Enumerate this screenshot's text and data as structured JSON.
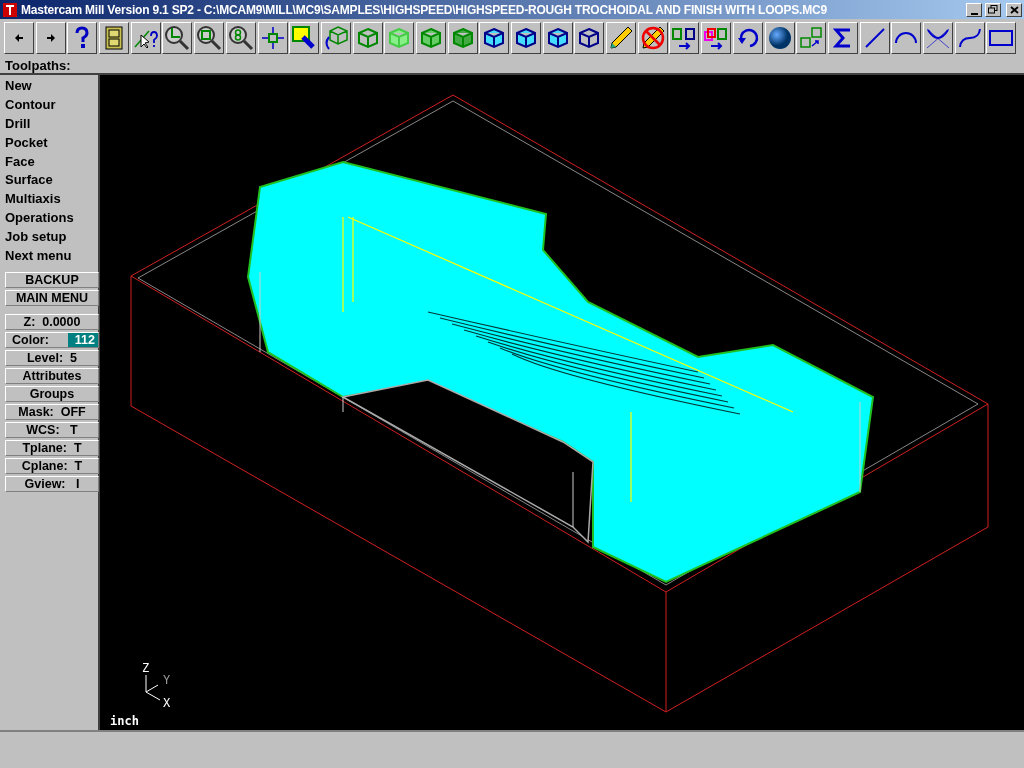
{
  "window": {
    "title": "Mastercam Mill Version 9.1 SP2 - C:\\MCAM9\\MILL\\MC9\\SAMPLES\\HIGHSPEED\\HIGHSPEED-ROUGH TROCHOIDAL AND FINISH WITH LOOPS.MC9"
  },
  "menu_title": "Toolpaths:",
  "menu_items": [
    {
      "label": "New"
    },
    {
      "label": "Contour"
    },
    {
      "label": "Drill"
    },
    {
      "label": "Pocket"
    },
    {
      "label": "Face"
    },
    {
      "label": "Surface"
    },
    {
      "label": "Multiaxis"
    },
    {
      "label": "Operations"
    },
    {
      "label": "Job setup"
    },
    {
      "label": "Next menu"
    }
  ],
  "nav_buttons": [
    "BACKUP",
    "MAIN MENU"
  ],
  "settings": [
    {
      "label": "Z:  0.0000"
    },
    {
      "label": "Color:",
      "value": "112",
      "color": "#008080"
    },
    {
      "label": "Level:  5"
    },
    {
      "label": "Attributes"
    },
    {
      "label": "Groups"
    },
    {
      "label": "Mask:  OFF"
    },
    {
      "label": "WCS:   T"
    },
    {
      "label": "Tplane:  T"
    },
    {
      "label": "Cplane:  T"
    },
    {
      "label": "Gview:   I"
    }
  ],
  "viewport": {
    "axis_labels": [
      "Z",
      "Y",
      "X"
    ],
    "units": "inch"
  }
}
